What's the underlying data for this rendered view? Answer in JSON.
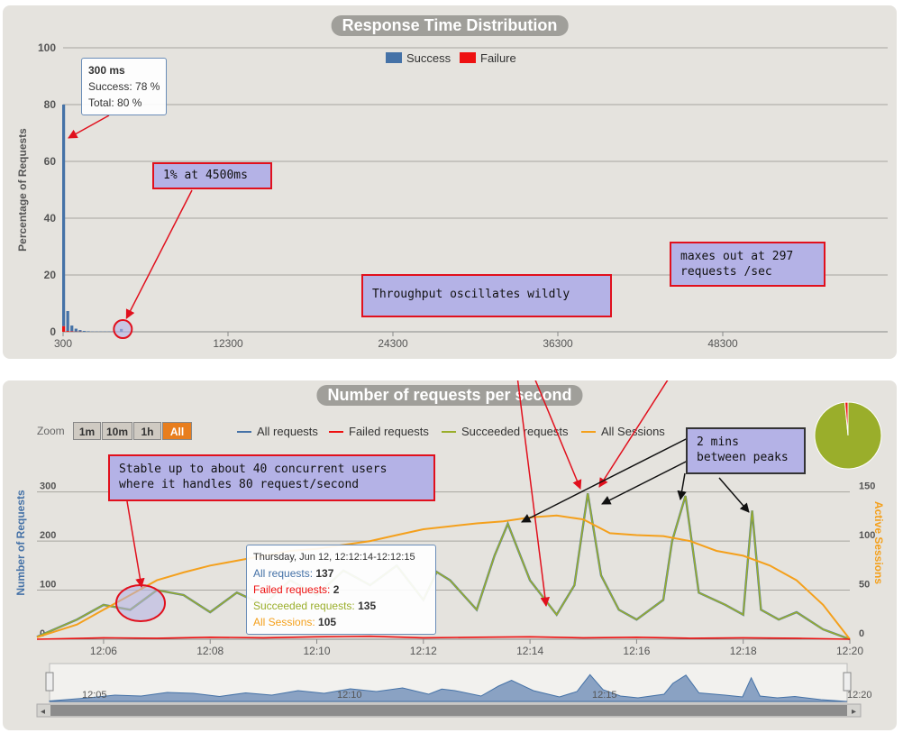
{
  "chart_data": [
    {
      "type": "bar",
      "title": "Response Time Distribution",
      "ylabel": "Percentage of Requests",
      "xlabel": "",
      "legend": [
        "Success",
        "Failure"
      ],
      "legend_position": "top-center",
      "colors": {
        "success": "#4572a7",
        "failure": "#ee1111"
      },
      "ylim": [
        0,
        100
      ],
      "yticks": [
        "0",
        "20",
        "40",
        "60",
        "80",
        "100"
      ],
      "xticks": [
        "300",
        "12300",
        "24300",
        "36300",
        "48300"
      ],
      "xlim": [
        300,
        60300
      ],
      "bin_width": 300,
      "x": [
        300,
        600,
        900,
        1200,
        1500,
        1800,
        2100,
        2400,
        2700,
        3000,
        3300,
        3600,
        3900,
        4200,
        4500
      ],
      "series": [
        {
          "name": "Success",
          "values": [
            78,
            7,
            2,
            1,
            0.5,
            0.3,
            0.2,
            0.1,
            0.1,
            0.1,
            0.1,
            0.1,
            0.1,
            0.1,
            1
          ]
        },
        {
          "name": "Failure",
          "values": [
            2,
            0.3,
            0.2,
            0.1,
            0.1,
            0,
            0,
            0,
            0,
            0,
            0,
            0,
            0,
            0,
            0
          ]
        }
      ],
      "tooltip": {
        "title": "300 ms",
        "success": "Success: 78 %",
        "total": "Total: 80 %"
      },
      "grid": true
    },
    {
      "type": "line",
      "title": "Number of requests per second",
      "ylabel": "Number of Requests",
      "y2label": "Active Sessions",
      "ylim": [
        0,
        325
      ],
      "y2lim": [
        0,
        162.5
      ],
      "yticks": [
        "0",
        "100",
        "200",
        "300"
      ],
      "y2ticks": [
        "0",
        "50",
        "100",
        "150"
      ],
      "xticks": [
        "12:06",
        "12:08",
        "12:10",
        "12:12",
        "12:14",
        "12:16",
        "12:18",
        "12:20"
      ],
      "x_start": "12:04:45",
      "x_end": "12:20:00",
      "grid": true,
      "legend": [
        "All requests",
        "Failed requests",
        "Succeeded requests",
        "All Sessions"
      ],
      "colors": {
        "all": "#4572a7",
        "failed": "#ee1111",
        "succeeded": "#9aae2b",
        "sessions": "#f4a01c"
      },
      "series": [
        {
          "name": "All Sessions",
          "axis": "right",
          "x": [
            "12:04:45",
            "12:05:30",
            "12:06:00",
            "12:06:30",
            "12:07:00",
            "12:07:30",
            "12:08:00",
            "12:08:30",
            "12:09:00",
            "12:09:30",
            "12:10:00",
            "12:10:30",
            "12:11:00",
            "12:11:30",
            "12:12:00",
            "12:12:30",
            "12:13:00",
            "12:13:30",
            "12:14:00",
            "12:14:30",
            "12:15:00",
            "12:15:30",
            "12:16:00",
            "12:16:30",
            "12:17:00",
            "12:17:30",
            "12:18:00",
            "12:18:30",
            "12:19:00",
            "12:19:30",
            "12:20:00"
          ],
          "values": [
            2,
            15,
            30,
            45,
            60,
            68,
            75,
            80,
            85,
            90,
            92,
            96,
            100,
            106,
            112,
            115,
            118,
            120,
            124,
            126,
            122,
            108,
            106,
            105,
            100,
            90,
            85,
            75,
            60,
            35,
            0
          ]
        },
        {
          "name": "All requests",
          "axis": "left",
          "x": [
            "12:04:45",
            "12:05:30",
            "12:06:00",
            "12:06:30",
            "12:07:00",
            "12:07:30",
            "12:08:00",
            "12:08:30",
            "12:09:00",
            "12:09:30",
            "12:10:00",
            "12:10:30",
            "12:11:00",
            "12:11:30",
            "12:12:00",
            "12:12:15",
            "12:12:30",
            "12:13:00",
            "12:13:20",
            "12:13:35",
            "12:14:00",
            "12:14:30",
            "12:14:50",
            "12:15:05",
            "12:15:20",
            "12:15:40",
            "12:16:00",
            "12:16:30",
            "12:16:40",
            "12:16:55",
            "12:17:10",
            "12:17:40",
            "12:18:00",
            "12:18:10",
            "12:18:20",
            "12:18:40",
            "12:19:00",
            "12:19:30",
            "12:20:00"
          ],
          "values": [
            5,
            40,
            70,
            60,
            100,
            90,
            55,
            95,
            70,
            120,
            90,
            140,
            110,
            150,
            80,
            137,
            120,
            60,
            170,
            235,
            120,
            50,
            110,
            297,
            130,
            60,
            40,
            80,
            200,
            292,
            95,
            70,
            50,
            262,
            60,
            40,
            55,
            20,
            0
          ]
        },
        {
          "name": "Failed requests",
          "axis": "left",
          "x": [
            "12:04:45",
            "12:06:00",
            "12:07:00",
            "12:08:00",
            "12:09:00",
            "12:10:00",
            "12:11:00",
            "12:12:00",
            "12:13:00",
            "12:14:00",
            "12:15:00",
            "12:16:00",
            "12:17:00",
            "12:18:00",
            "12:19:00",
            "12:20:00"
          ],
          "values": [
            0,
            3,
            2,
            4,
            3,
            5,
            6,
            3,
            4,
            5,
            3,
            4,
            2,
            3,
            2,
            0
          ]
        }
      ],
      "tooltip": {
        "header": "Thursday, Jun 12, 12:12:14-12:12:15",
        "all_label": "All requests:",
        "all": "137",
        "failed_label": "Failed requests:",
        "failed": "2",
        "succeeded_label": "Succeeded requests:",
        "succeeded": "135",
        "sessions_label": "All Sessions:",
        "sessions": "105"
      },
      "zoom": {
        "label": "Zoom",
        "buttons": [
          "1m",
          "10m",
          "1h",
          "All"
        ],
        "active": "All"
      },
      "navigator": {
        "ticks": [
          "12:05",
          "12:10",
          "12:15",
          "12:20"
        ]
      },
      "pie": {
        "slices": [
          {
            "name": "Succeeded",
            "value": 98.5,
            "color": "#9aae2b"
          },
          {
            "name": "Failed",
            "value": 1.5,
            "color": "#ee1111"
          }
        ]
      }
    }
  ],
  "annotations": {
    "a1": "1% at 4500ms",
    "a2": "maxes out at 297\nrequests /sec",
    "a3": "Throughput oscillates wildly",
    "a4": "Stable up to about 40 concurrent users\nwhere it handles 80 request/second",
    "a5": "2 mins\nbetween peaks"
  }
}
